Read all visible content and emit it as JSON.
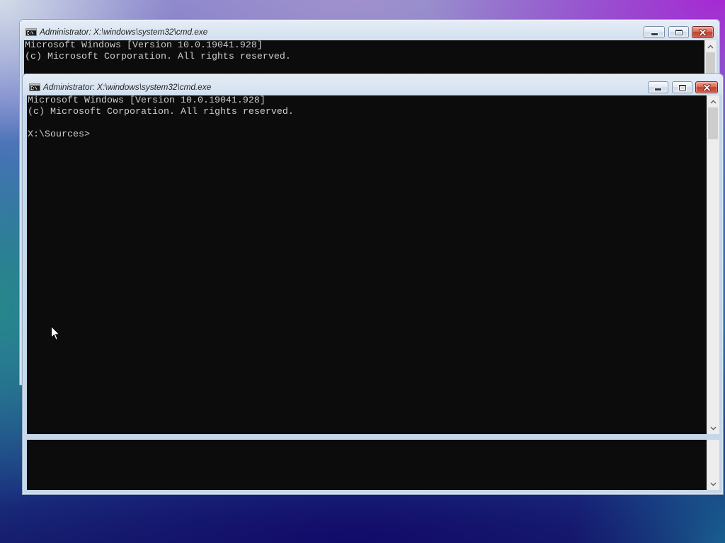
{
  "colors": {
    "console_background": "#0c0c0c",
    "console_text": "#cccccc",
    "window_frame": "#c5d7ea",
    "title_text": "#1f1f1f",
    "close_button": "#c9453a"
  },
  "icons": {
    "app": "cmd-icon",
    "minimize": "minimize-icon",
    "maximize": "maximize-icon",
    "close": "close-icon",
    "scroll_up": "scroll-up-arrow-icon",
    "scroll_down": "scroll-down-arrow-icon",
    "pointer": "mouse-pointer-icon"
  },
  "windows": [
    {
      "title": "Administrator: X:\\windows\\system32\\cmd.exe",
      "console_lines": [
        "Microsoft Windows [Version 10.0.19041.928]",
        "(c) Microsoft Corporation. All rights reserved."
      ],
      "scroll_position": 0
    },
    {
      "title": "Administrator: X:\\windows\\system32\\cmd.exe",
      "console_lines": [
        "Microsoft Windows [Version 10.0.19041.928]",
        "(c) Microsoft Corporation. All rights reserved.",
        "",
        "X:\\Sources>"
      ],
      "scroll_position": 0
    }
  ]
}
